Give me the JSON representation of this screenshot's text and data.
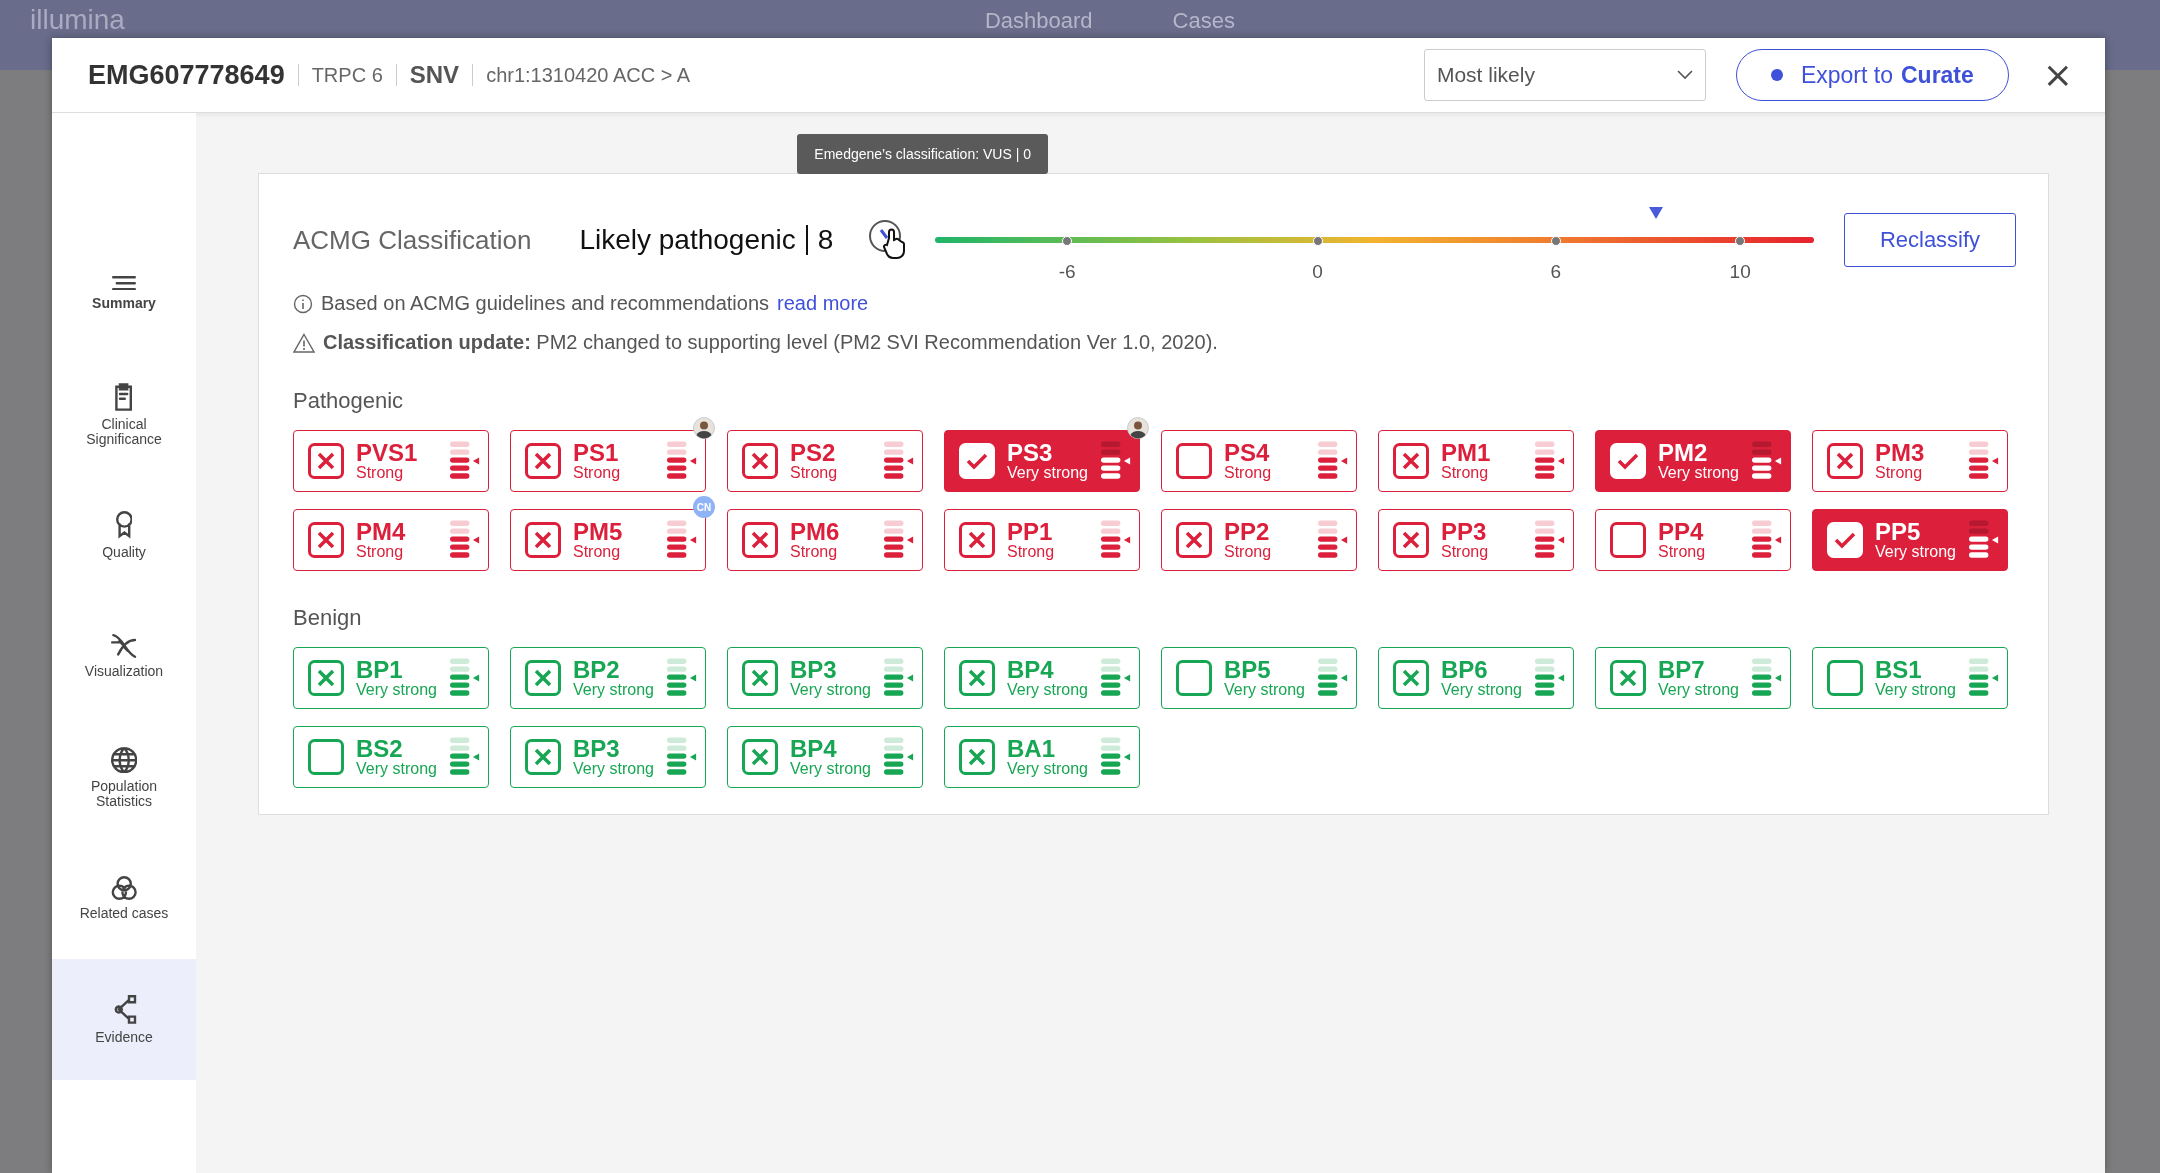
{
  "backdrop_nav": {
    "logo": "illumina",
    "links": [
      "Dashboard",
      "Cases"
    ]
  },
  "header": {
    "id": "EMG607778649",
    "gene": "TRPC 6",
    "variant_type": "SNV",
    "position": "chr1:1310420 ACC > A",
    "dropdown": {
      "value": "Most likely"
    },
    "export_button": {
      "prefix": "Export to",
      "brand": "Curate"
    },
    "close": "×"
  },
  "sidebar": {
    "items": [
      {
        "label": "Summary",
        "kind": "lines",
        "selected": false,
        "bold": true
      },
      {
        "label": "Clinical Significance",
        "kind": "clipboard",
        "selected": false,
        "bold": false
      },
      {
        "label": "Quality",
        "kind": "ribbon",
        "selected": false,
        "bold": false
      },
      {
        "label": "Visualization",
        "kind": "dna",
        "selected": false,
        "bold": false
      },
      {
        "label": "Population Statistics",
        "kind": "globe",
        "selected": false,
        "bold": false
      },
      {
        "label": "Related cases",
        "kind": "circles",
        "selected": false,
        "bold": false
      },
      {
        "label": "Evidence",
        "kind": "share",
        "selected": true,
        "bold": false
      }
    ]
  },
  "classification": {
    "title": "ACMG Classification",
    "result": "Likely pathogenic",
    "score": "8",
    "tooltip": "Emedgene’s classification: VUS | 0",
    "scale": {
      "level": 0.82,
      "ticks": [
        "-6",
        "0",
        "6",
        "10"
      ]
    },
    "reclassify_button": "Reclassify",
    "info": {
      "text": "Based on ACMG guidelines and recommendations",
      "link": "read more"
    },
    "update": "**Classification update:** PM2 changed to supporting level (PM2 SVI Recommendation Ver 1.0, 2020)."
  },
  "groups": [
    {
      "title": "Pathogenic",
      "kind": "pathogenic",
      "criteria": [
        {
          "code": "PVS1",
          "strength": "Strong",
          "checked": false,
          "rejected": true
        },
        {
          "code": "PS1",
          "strength": "Strong",
          "checked": false,
          "rejected": true,
          "badge": {
            "kind": "avatar"
          }
        },
        {
          "code": "PS2",
          "strength": "Strong",
          "checked": false,
          "rejected": true
        },
        {
          "code": "PS3",
          "strength": "Very strong",
          "checked": true,
          "rejected": false,
          "badge": {
            "kind": "avatar"
          }
        },
        {
          "code": "PS4",
          "strength": "Strong",
          "checked": false,
          "rejected": false
        },
        {
          "code": "PM1",
          "strength": "Strong",
          "checked": false,
          "rejected": true
        },
        {
          "code": "PM2",
          "strength": "Very strong",
          "checked": true,
          "rejected": false
        },
        {
          "code": "PM3",
          "strength": "Strong",
          "checked": false,
          "rejected": true
        },
        {
          "code": "PM4",
          "strength": "Strong",
          "checked": false,
          "rejected": true
        },
        {
          "code": "PM5",
          "strength": "Strong",
          "checked": false,
          "rejected": true,
          "badge": {
            "kind": "initials",
            "text": "CN"
          }
        },
        {
          "code": "PM6",
          "strength": "Strong",
          "checked": false,
          "rejected": true
        },
        {
          "code": "PP1",
          "strength": "Strong",
          "checked": false,
          "rejected": true
        },
        {
          "code": "PP2",
          "strength": "Strong",
          "checked": false,
          "rejected": true
        },
        {
          "code": "PP3",
          "strength": "Strong",
          "checked": false,
          "rejected": true
        },
        {
          "code": "PP4",
          "strength": "Strong",
          "checked": false,
          "rejected": false
        },
        {
          "code": "PP5",
          "strength": "Very strong",
          "checked": true,
          "rejected": false
        }
      ]
    },
    {
      "title": "Benign",
      "kind": "benign",
      "criteria": [
        {
          "code": "BP1",
          "strength": "Very strong",
          "checked": false,
          "rejected": true
        },
        {
          "code": "BP2",
          "strength": "Very strong",
          "checked": false,
          "rejected": true
        },
        {
          "code": "BP3",
          "strength": "Very strong",
          "checked": false,
          "rejected": true
        },
        {
          "code": "BP4",
          "strength": "Very strong",
          "checked": false,
          "rejected": true
        },
        {
          "code": "BP5",
          "strength": "Very strong",
          "checked": false,
          "rejected": false
        },
        {
          "code": "BP6",
          "strength": "Very strong",
          "checked": false,
          "rejected": true
        },
        {
          "code": "BP7",
          "strength": "Very strong",
          "checked": false,
          "rejected": true
        },
        {
          "code": "BS1",
          "strength": "Very strong",
          "checked": false,
          "rejected": false
        },
        {
          "code": "BS2",
          "strength": "Very strong",
          "checked": false,
          "rejected": false
        },
        {
          "code": "BP3",
          "strength": "Very strong",
          "checked": false,
          "rejected": true
        },
        {
          "code": "BP4",
          "strength": "Very strong",
          "checked": false,
          "rejected": true
        },
        {
          "code": "BA1",
          "strength": "Very strong",
          "checked": false,
          "rejected": true
        }
      ]
    }
  ]
}
